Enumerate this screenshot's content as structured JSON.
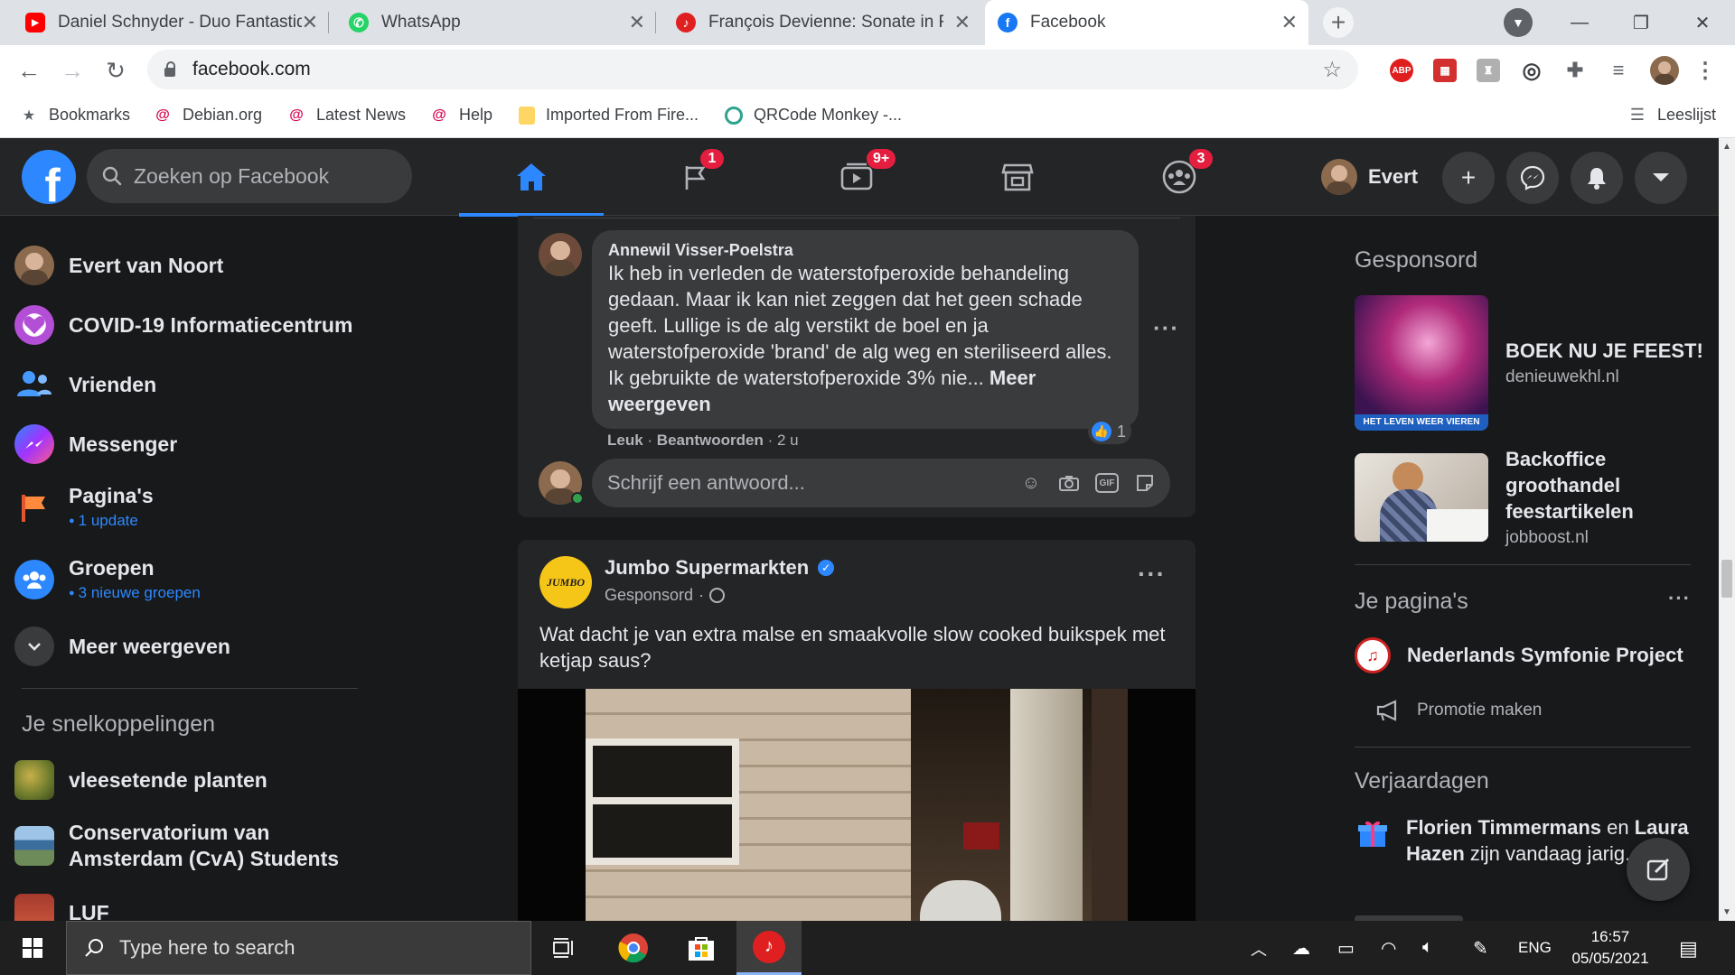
{
  "browser": {
    "tabs": [
      {
        "title": "Daniel Schnyder - Duo Fantastiqu",
        "icon": "youtube-icon"
      },
      {
        "title": "WhatsApp",
        "icon": "whatsapp-icon"
      },
      {
        "title": "François Devienne: Sonate in F op",
        "icon": "media-player-icon"
      },
      {
        "title": "Facebook",
        "icon": "facebook-icon"
      }
    ],
    "url": "facebook.com",
    "bookmarks": [
      {
        "label": "Bookmarks"
      },
      {
        "label": "Debian.org"
      },
      {
        "label": "Latest News"
      },
      {
        "label": "Help"
      },
      {
        "label": "Imported From Fire..."
      },
      {
        "label": "QRCode Monkey -..."
      }
    ],
    "reading_list": "Leeslijst",
    "ext_abp": "ABP"
  },
  "fb": {
    "search_placeholder": "Zoeken op Facebook",
    "badges": {
      "pages": "1",
      "watch": "9+",
      "groups": "3"
    },
    "profile_name": "Evert"
  },
  "left": {
    "profile": "Evert van Noort",
    "items": [
      {
        "label": "COVID-19 Informatiecentrum"
      },
      {
        "label": "Vrienden"
      },
      {
        "label": "Messenger"
      },
      {
        "label": "Pagina's",
        "sub": "1 update"
      },
      {
        "label": "Groepen",
        "sub": "3 nieuwe groepen"
      },
      {
        "label": "Meer weergeven"
      }
    ],
    "shortcuts_title": "Je snelkoppelingen",
    "shortcuts": [
      {
        "label": "vleesetende planten"
      },
      {
        "label": "Conservatorium van Amsterdam (CvA) Students"
      },
      {
        "label": "LUF"
      }
    ]
  },
  "feed": {
    "comment": {
      "author": "Annewil Visser-Poelstra",
      "text": "Ik heb in verleden de waterstofperoxide behandeling gedaan. Maar ik kan niet zeggen dat het geen schade geeft. Lullige is de alg verstikt de boel en ja waterstofperoxide 'brand' de alg weg en steriliseerd alles. Ik gebruikte de waterstofperoxide 3% nie...",
      "more": "Meer weergeven",
      "likes": "1",
      "like_label": "Leuk",
      "reply_label": "Beantwoorden",
      "time": "2 u"
    },
    "reply_placeholder": "Schrijf een antwoord...",
    "post": {
      "page_name": "Jumbo Supermarkten",
      "logo_text": "JUMBO",
      "sponsored": "Gesponsord",
      "text": "Wat dacht je van extra malse en smaakvolle slow cooked buikspek met ketjap saus?"
    }
  },
  "right": {
    "sponsored_title": "Gesponsord",
    "ads": [
      {
        "title": "BOEK NU JE FEEST!",
        "site": "denieuwekhl.nl",
        "caption": "HET LEVEN WEER VIEREN"
      },
      {
        "title": "Backoffice groothandel feestartikelen",
        "site": "jobboost.nl"
      }
    ],
    "pages_title": "Je pagina's",
    "page_name": "Nederlands Symfonie Project",
    "promote": "Promotie maken",
    "birthdays_title": "Verjaardagen",
    "birthday_name1": "Florien Timmermans",
    "birthday_and": " en ",
    "birthday_name2": "Laura Hazen",
    "birthday_suffix": " zijn vandaag jarig."
  },
  "taskbar": {
    "search_placeholder": "Type here to search",
    "lang": "ENG",
    "time": "16:57",
    "date": "05/05/2021"
  }
}
